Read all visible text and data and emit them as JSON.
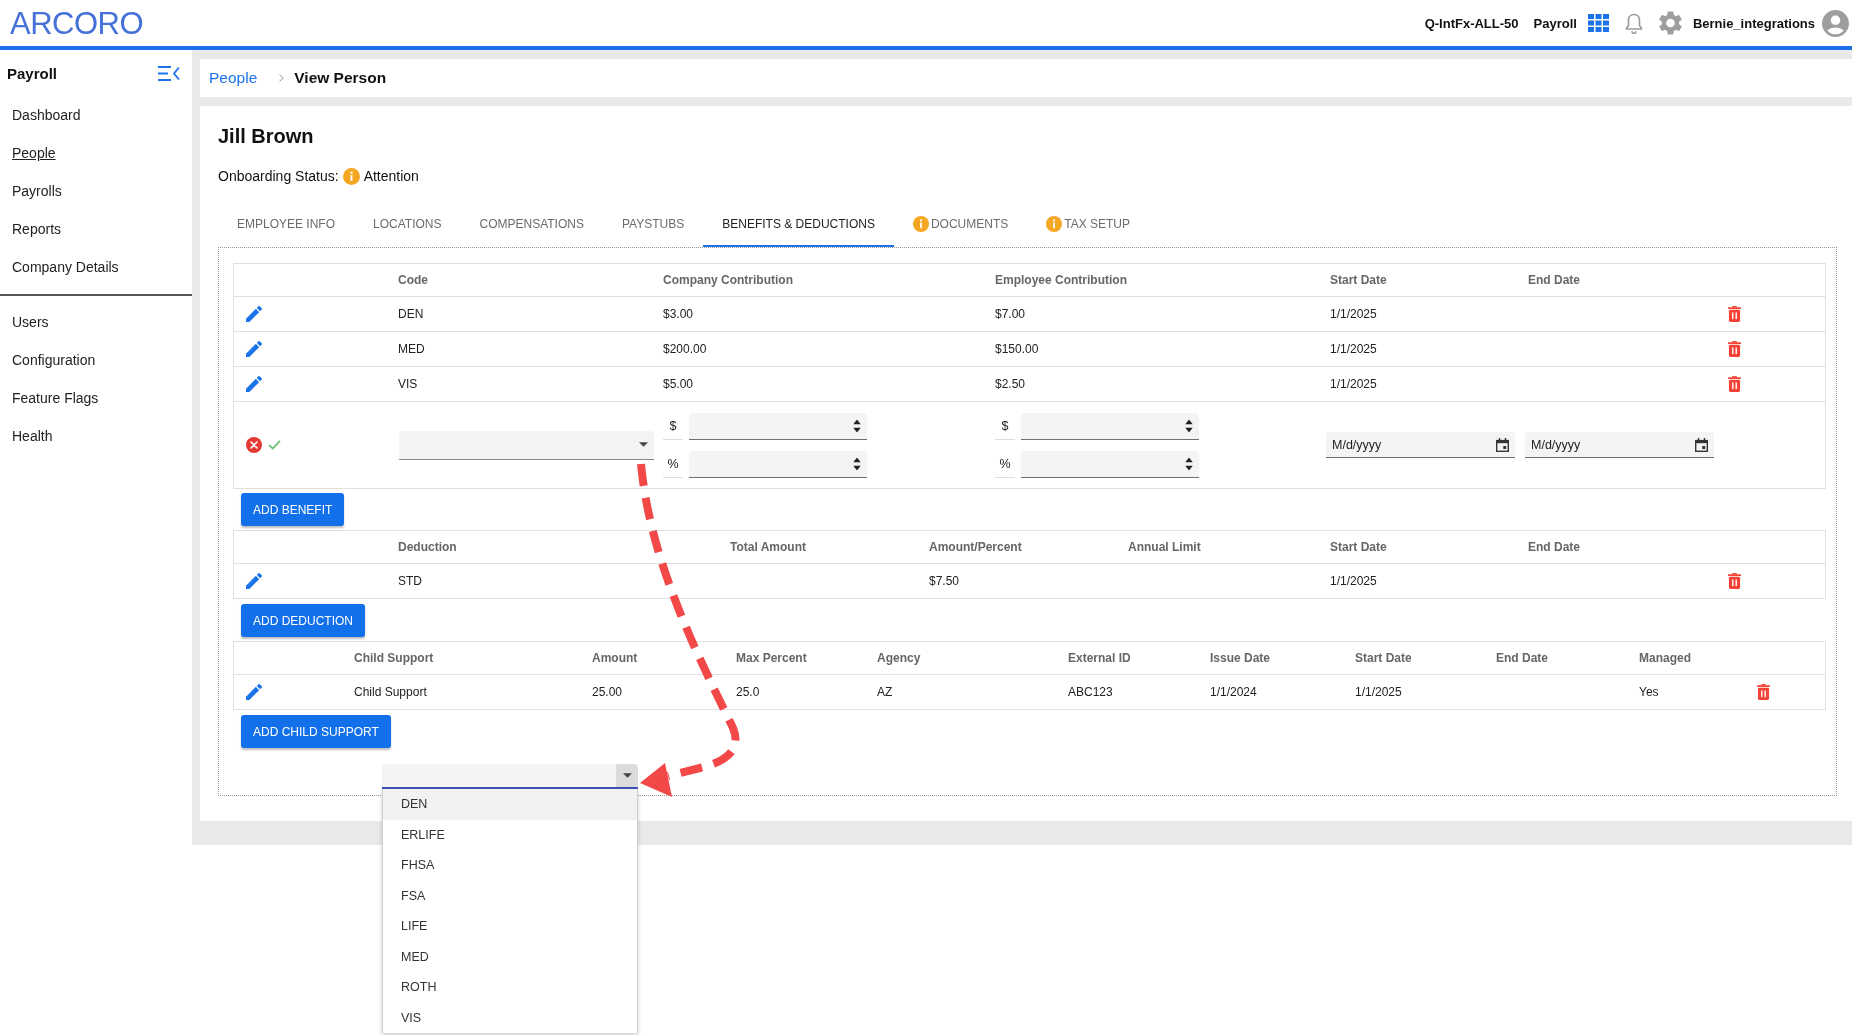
{
  "top_bar": {
    "logo": "ARCORO",
    "environment": "Q-IntFx-ALL-50",
    "product": "Payroll",
    "user": "Bernie_integrations"
  },
  "sidebar": {
    "title": "Payroll",
    "groups": [
      {
        "items": [
          {
            "label": "Dashboard",
            "selected": false
          },
          {
            "label": "People",
            "selected": true
          },
          {
            "label": "Payrolls",
            "selected": false
          },
          {
            "label": "Reports",
            "selected": false
          },
          {
            "label": "Company Details",
            "selected": false
          }
        ]
      },
      {
        "items": [
          {
            "label": "Users",
            "selected": false
          },
          {
            "label": "Configuration",
            "selected": false
          },
          {
            "label": "Feature Flags",
            "selected": false
          },
          {
            "label": "Health",
            "selected": false
          }
        ]
      }
    ]
  },
  "breadcrumb": {
    "link": "People",
    "current": "View Person"
  },
  "person": {
    "name": "Jill Brown",
    "onboarding_label": "Onboarding Status:",
    "onboarding_status": "Attention",
    "onboarding_warning": true
  },
  "tabs": [
    {
      "label": "EMPLOYEE INFO",
      "selected": false,
      "warning": false
    },
    {
      "label": "LOCATIONS",
      "selected": false,
      "warning": false
    },
    {
      "label": "COMPENSATIONS",
      "selected": false,
      "warning": false
    },
    {
      "label": "PAYSTUBS",
      "selected": false,
      "warning": false
    },
    {
      "label": "BENEFITS & DEDUCTIONS",
      "selected": true,
      "warning": false
    },
    {
      "label": "DOCUMENTS",
      "selected": false,
      "warning": true
    },
    {
      "label": "TAX SETUP",
      "selected": false,
      "warning": true
    }
  ],
  "benefits": {
    "columns": [
      "Code",
      "Company Contribution",
      "Employee Contribution",
      "Start Date",
      "End Date"
    ],
    "rows": [
      {
        "code": "DEN",
        "company_contribution": "$3.00",
        "employee_contribution": "$7.00",
        "start_date": "1/1/2025"
      },
      {
        "code": "MED",
        "company_contribution": "$200.00",
        "employee_contribution": "$150.00",
        "start_date": "1/1/2025"
      },
      {
        "code": "VIS",
        "company_contribution": "$5.00",
        "employee_contribution": "$2.50",
        "start_date": "1/1/2025"
      }
    ],
    "new_row": {
      "code_select": {
        "expanded": false
      },
      "company_contribution": {
        "amount_symbol": "$",
        "percent_symbol": "%"
      },
      "employee_contribution": {
        "amount_symbol": "$",
        "percent_symbol": "%"
      },
      "start_date": {
        "placeholder": "M/d/yyyy"
      },
      "end_date": {
        "placeholder": "M/d/yyyy"
      }
    },
    "add_button": "ADD BENEFIT"
  },
  "deductions": {
    "columns": [
      "Deduction",
      "Total Amount",
      "Amount/Percent",
      "Annual Limit",
      "Start Date",
      "End Date"
    ],
    "rows": [
      {
        "deduction": "STD",
        "amount_percent": "$7.50",
        "start_date": "1/1/2025"
      }
    ],
    "add_button": "ADD DEDUCTION"
  },
  "child_support": {
    "columns": [
      "Child Support",
      "Amount",
      "Max Percent",
      "Agency",
      "External ID",
      "Issue Date",
      "Start Date",
      "End Date",
      "Managed"
    ],
    "rows": [
      {
        "child_support": "Child Support",
        "amount": "25.00",
        "max_percent": "25.0",
        "agency": "AZ",
        "external_id": "ABC123",
        "issue_date": "1/1/2024",
        "start_date": "1/1/2025",
        "managed": "Yes"
      }
    ],
    "add_button": "ADD CHILD SUPPORT"
  },
  "code_dropdown": {
    "expanded": true,
    "options": [
      {
        "label": "DEN",
        "selected": true
      },
      {
        "label": "ERLIFE",
        "selected": false
      },
      {
        "label": "FHSA",
        "selected": false
      },
      {
        "label": "FSA",
        "selected": false
      },
      {
        "label": "LIFE",
        "selected": false
      },
      {
        "label": "MED",
        "selected": false
      },
      {
        "label": "ROTH",
        "selected": false
      },
      {
        "label": "VIS",
        "selected": false
      }
    ]
  },
  "annotations": [
    {
      "kind": "dashed-arrow"
    }
  ]
}
